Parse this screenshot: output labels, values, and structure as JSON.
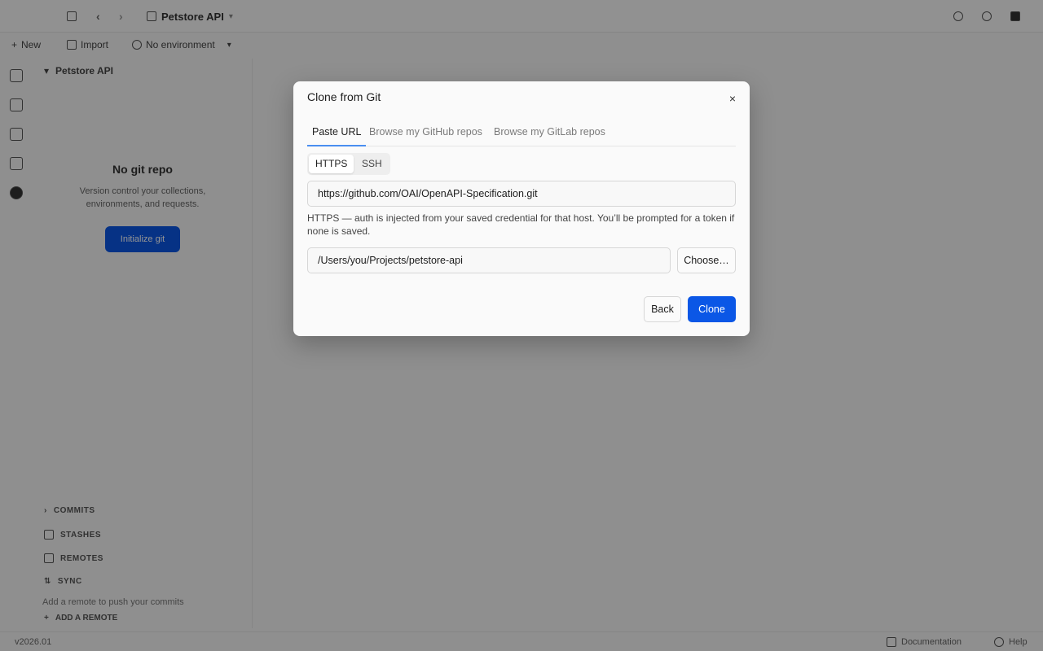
{
  "app": {
    "workspace_name": "Petstore API",
    "toolbar": {
      "new_label": "New",
      "import_label": "Import",
      "env_label": "No environment"
    },
    "sidebar": {
      "workspace_label": "Petstore API",
      "empty_title": "No git repo",
      "empty_desc": "Version control your collections, environments, and requests.",
      "empty_button": "Initialize git",
      "sections": [
        "COMMITS",
        "STASHES",
        "REMOTES",
        "SYNC"
      ],
      "hint": "Add a remote to push your commits",
      "action": "ADD A REMOTE"
    },
    "status": {
      "version": "v2026.01",
      "docs": "Documentation",
      "help": "Help"
    }
  },
  "modal": {
    "title": "Clone from Git",
    "close_glyph": "×",
    "tabs": [
      {
        "label": "Paste URL",
        "active": true
      },
      {
        "label": "Browse my GitHub repos",
        "active": false
      },
      {
        "label": "Browse my GitLab repos",
        "active": false
      }
    ],
    "protocol": {
      "options": [
        "HTTPS",
        "SSH"
      ],
      "selected": "HTTPS"
    },
    "url_value": "https://github.com/OAI/OpenAPI-Specification.git",
    "hint": "HTTPS — auth is injected from your saved credential for that host. You’ll be prompted for a token if none is saved.",
    "path_value": "/Users/you/Projects/petstore-api",
    "choose_label": "Choose…",
    "back_label": "Back",
    "clone_label": "Clone"
  },
  "colors": {
    "accent": "#0b57e6",
    "tab_underline": "#4a8ef0",
    "overlay": "rgba(0,0,0,0.42)"
  }
}
